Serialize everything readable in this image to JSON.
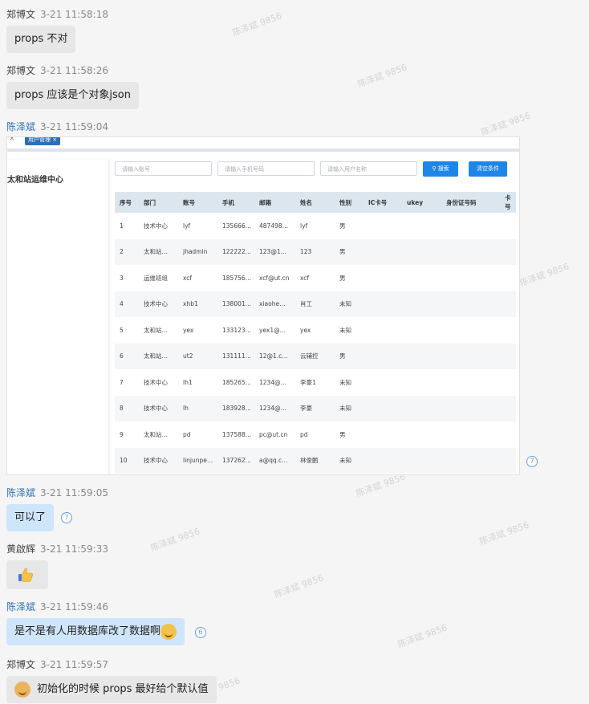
{
  "messages": [
    {
      "sender": "郑博文",
      "time": "3-21 11:58:18",
      "text": "props 不对"
    },
    {
      "sender": "郑博文",
      "time": "3-21 11:58:26",
      "text": "props 应该是个对象json"
    },
    {
      "sender": "陈泽斌",
      "time": "3-21 11:59:04"
    },
    {
      "sender": "陈泽斌",
      "time": "3-21 11:59:05",
      "text": "可以了",
      "read": "7"
    },
    {
      "sender": "黄啟辉",
      "time": "3-21 11:59:33"
    },
    {
      "sender": "陈泽斌",
      "time": "3-21 11:59:46",
      "text": "是不是有人用数据库改了数据啊",
      "read": "6"
    },
    {
      "sender": "郑博文",
      "time": "3-21 11:59:57",
      "text": "初始化的时候 props 最好给个默认值"
    }
  ],
  "image_read": "7",
  "watermark": "陈泽斌 9856",
  "shot": {
    "tab": "用户管理",
    "close": "×",
    "org": "太和站运维中心",
    "placeholders": [
      "请输入账号",
      "请输入手机号码",
      "请输入用户名称"
    ],
    "search_btn": "搜索",
    "reset_btn": "清空条件",
    "columns": [
      "序号",
      "部门",
      "账号",
      "手机",
      "邮箱",
      "姓名",
      "性别",
      "IC卡号",
      "ukey",
      "身份证号码",
      "卡号"
    ],
    "rows": [
      [
        "1",
        "技术中心",
        "lyf",
        "135666…",
        "487498…",
        "lyf",
        "男"
      ],
      [
        "2",
        "太和站…",
        "jhadmin",
        "122222…",
        "123@1…",
        "123",
        "男"
      ],
      [
        "3",
        "运维班组",
        "xcf",
        "185756…",
        "xcf@ut.cn",
        "xcf",
        "男"
      ],
      [
        "4",
        "技术中心",
        "xhb1",
        "138001…",
        "xiaohe…",
        "肖工",
        "未知"
      ],
      [
        "5",
        "太和站…",
        "yex",
        "133123…",
        "yex1@…",
        "yex",
        "未知"
      ],
      [
        "6",
        "太和站…",
        "ut2",
        "131111…",
        "12@1.c…",
        "云辅控",
        "男"
      ],
      [
        "7",
        "技术中心",
        "lh1",
        "185265…",
        "1234@…",
        "李豪1",
        "未知"
      ],
      [
        "8",
        "技术中心",
        "lh",
        "183928…",
        "1234@…",
        "李豪",
        "未知"
      ],
      [
        "9",
        "太和站…",
        "pd",
        "137588…",
        "pc@ut.cn",
        "pd",
        "男"
      ],
      [
        "10",
        "技术中心",
        "linjunpe…",
        "137262…",
        "a@qq.c…",
        "林俊鹏",
        "未知"
      ]
    ]
  },
  "colors": {
    "accent": "#1e86e8",
    "self_name": "#2d6fb7",
    "bubble_blue": "#cfe5fb",
    "bubble_grey": "#e7e7e7"
  }
}
